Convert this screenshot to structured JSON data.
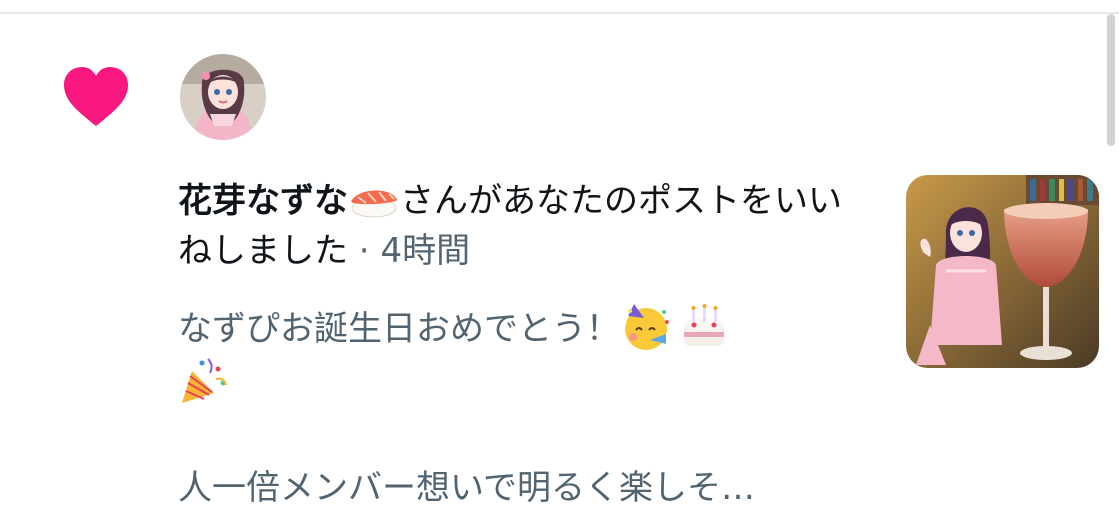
{
  "notification": {
    "user_name": "花芽なずな",
    "action_text": "さんがあなたのポストをいいねしました",
    "meta_separator": " · ",
    "time_ago": "4時間",
    "icon": "heart-icon",
    "name_emoji": "sushi-emoji"
  },
  "post": {
    "line1": "なずぴお誕生日おめでとう！",
    "emojis": [
      "partying-face-emoji",
      "birthday-cake-emoji",
      "party-popper-emoji"
    ],
    "preview": "人一倍メンバー想いで明るく楽しそ…"
  },
  "colors": {
    "heart": "#f91880",
    "primary_text": "#0f1419",
    "secondary_text": "#536471"
  }
}
